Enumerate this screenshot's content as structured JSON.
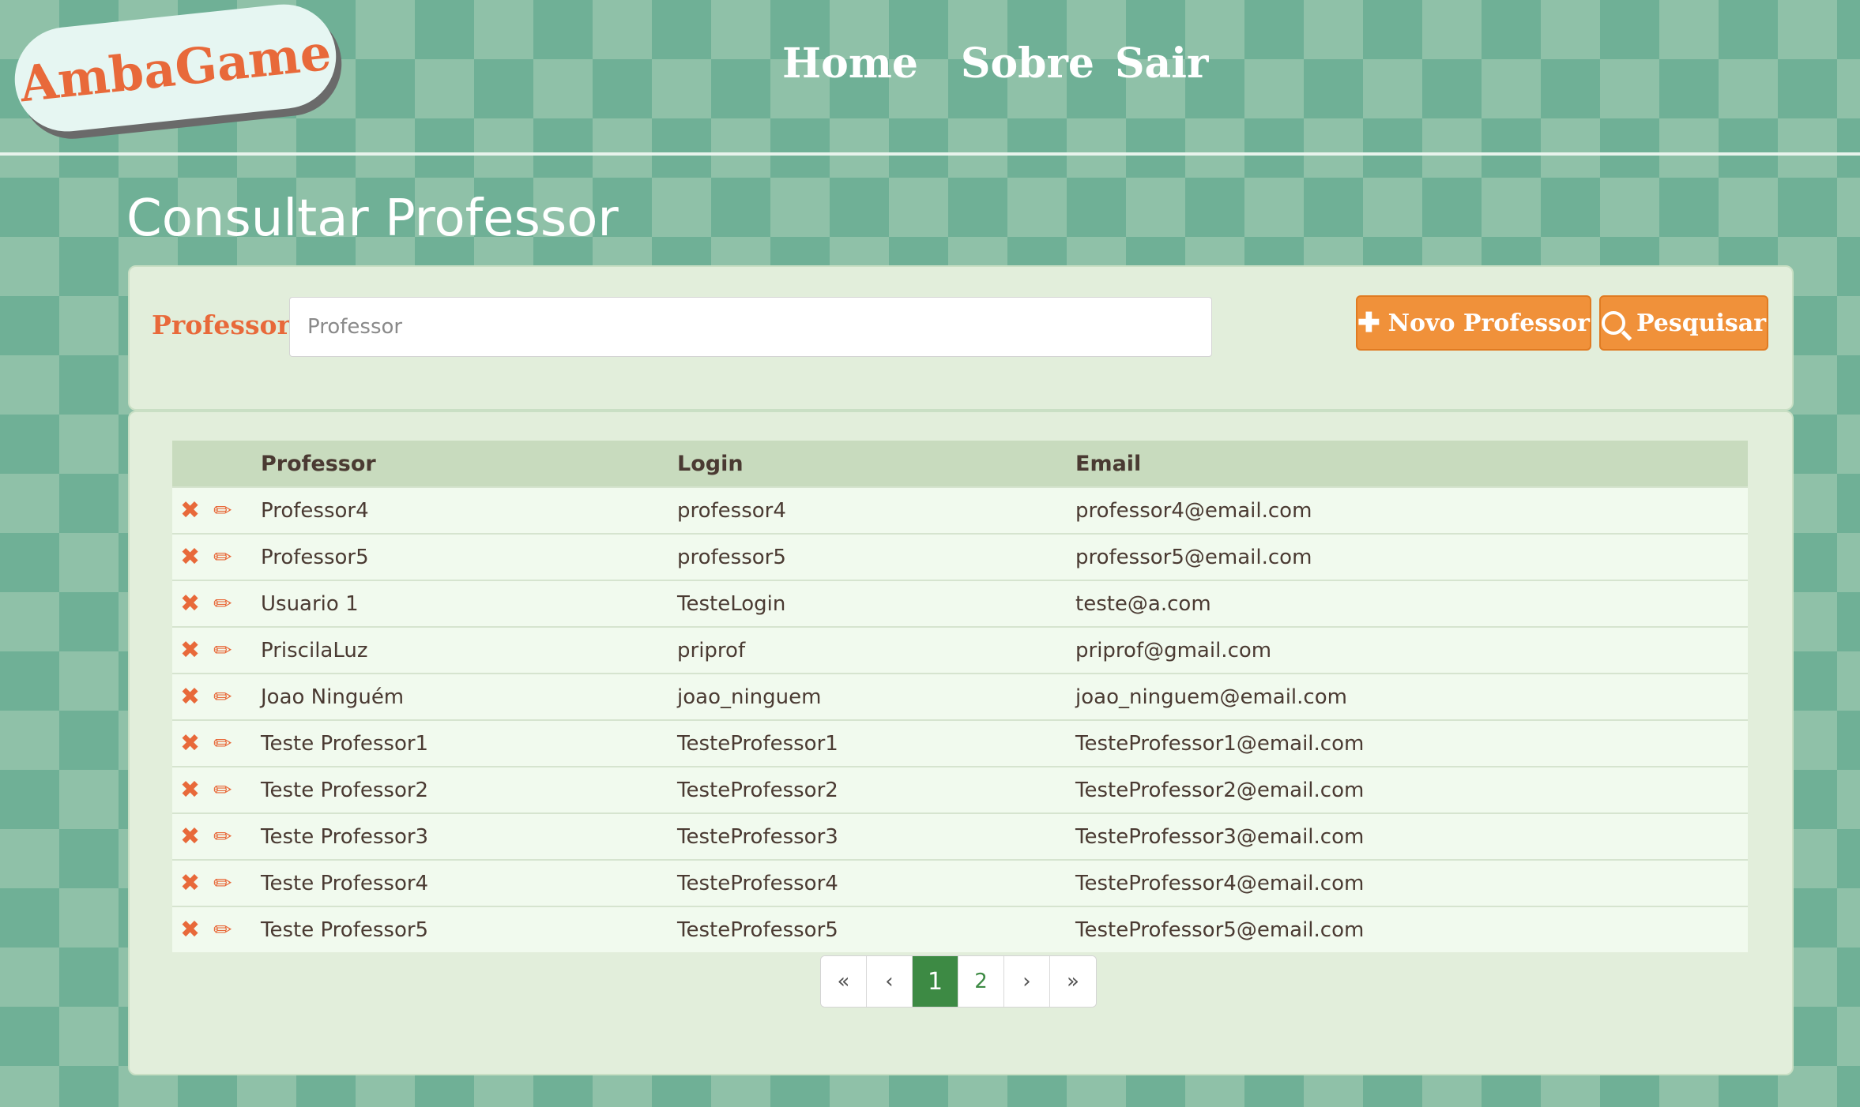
{
  "brand": {
    "logo_text": "AmbaGame"
  },
  "nav": {
    "home": "Home",
    "sobre": "Sobre",
    "sair": "Sair"
  },
  "page": {
    "title": "Consultar Professor"
  },
  "search": {
    "label": "Professor:",
    "placeholder": "Professor",
    "value": "",
    "new_button": "Novo Professor",
    "search_button": "Pesquisar",
    "new_icon": "plus-icon",
    "search_icon": "magnifier-icon"
  },
  "table": {
    "headers": {
      "professor": "Professor",
      "login": "Login",
      "email": "Email"
    },
    "row_icons": {
      "delete": "x-icon",
      "edit": "pencil-icon"
    },
    "rows": [
      {
        "professor": "Professor4",
        "login": "professor4",
        "email": "professor4@email.com"
      },
      {
        "professor": "Professor5",
        "login": "professor5",
        "email": "professor5@email.com"
      },
      {
        "professor": "Usuario 1",
        "login": "TesteLogin",
        "email": "teste@a.com"
      },
      {
        "professor": "PriscilaLuz",
        "login": "priprof",
        "email": "priprof@gmail.com"
      },
      {
        "professor": "Joao Ninguém",
        "login": "joao_ninguem",
        "email": "joao_ninguem@email.com"
      },
      {
        "professor": "Teste Professor1",
        "login": "TesteProfessor1",
        "email": "TesteProfessor1@email.com"
      },
      {
        "professor": "Teste Professor2",
        "login": "TesteProfessor2",
        "email": "TesteProfessor2@email.com"
      },
      {
        "professor": "Teste Professor3",
        "login": "TesteProfessor3",
        "email": "TesteProfessor3@email.com"
      },
      {
        "professor": "Teste Professor4",
        "login": "TesteProfessor4",
        "email": "TesteProfessor4@email.com"
      },
      {
        "professor": "Teste Professor5",
        "login": "TesteProfessor5",
        "email": "TesteProfessor5@email.com"
      }
    ]
  },
  "pagination": {
    "first": "«",
    "prev": "‹",
    "pages": [
      "1",
      "2"
    ],
    "current": "1",
    "next": "›",
    "last": "»"
  },
  "colors": {
    "accent": "#f0913a",
    "brand_orange": "#e8693a",
    "pagination_active": "#3d8a44",
    "panel": "#e2eedb",
    "background_light": "#8fc1a8",
    "background_dark": "#6fb096"
  }
}
